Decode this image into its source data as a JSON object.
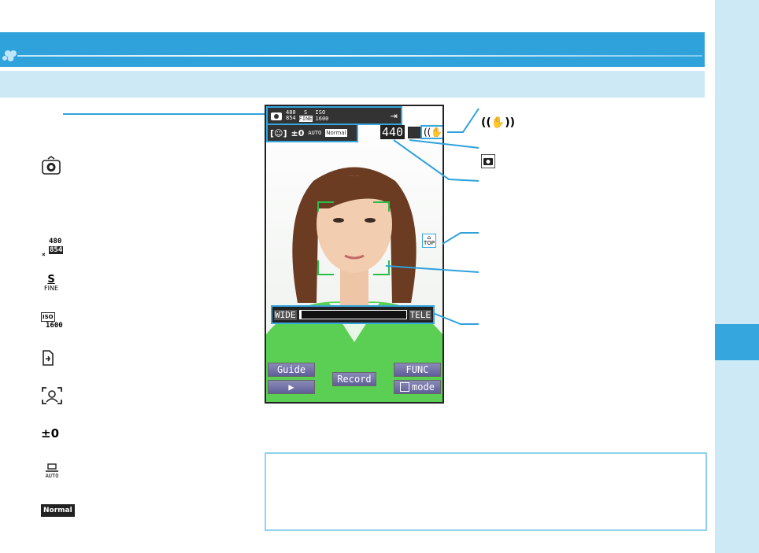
{
  "screen": {
    "status": {
      "res_top": "480",
      "res_bottom": "854",
      "quality_letter": "S",
      "quality_word": "FINE",
      "iso_label": "ISO",
      "iso_value": "1600",
      "exposure": "±0",
      "wb_auto": "AUTO",
      "scene": "Normal"
    },
    "shots_remaining": "440",
    "zoom": {
      "wide": "WIDE",
      "tele": "TELE",
      "level": 0.02
    },
    "softkeys": {
      "guide": "Guide",
      "play": "▶",
      "record": "Record",
      "func": "FUNC",
      "mode": "mode"
    },
    "top_indicator": "TOP"
  },
  "legend_icons": [
    {
      "icon": "camera-icon"
    },
    {
      "icon": "image-size-icon",
      "top": "480",
      "bottom": "854"
    },
    {
      "icon": "quality-fine-icon",
      "letter": "S",
      "word": "FINE"
    },
    {
      "icon": "iso-icon",
      "label": "ISO",
      "value": "1600"
    },
    {
      "icon": "storage-icon"
    },
    {
      "icon": "face-detect-icon"
    },
    {
      "icon": "exposure-icon",
      "value": "±0"
    },
    {
      "icon": "white-balance-icon",
      "label": "AUTO"
    },
    {
      "icon": "scene-icon",
      "label": "Normal"
    }
  ],
  "callout_icons": [
    "shake-icon",
    "camera-small-icon"
  ],
  "colors": {
    "accent": "#2fa2dc",
    "light": "#cde9f5",
    "frame": "#36a6df",
    "focus": "#2bbd4a"
  }
}
